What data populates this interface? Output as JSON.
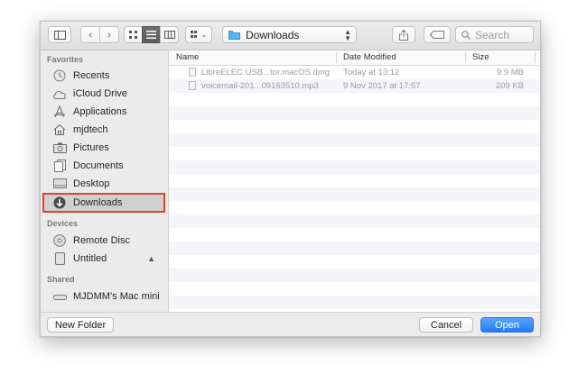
{
  "toolbar": {
    "sidebar_toggle_icon": "sidebar-icon",
    "back_icon": "chevron-left-icon",
    "forward_icon": "chevron-right-icon",
    "view_modes": [
      "icon-view-icon",
      "list-view-icon",
      "column-view-icon"
    ],
    "group_icon": "group-by-icon",
    "location": "Downloads",
    "share_icon": "share-icon",
    "tags_icon": "tag-icon",
    "search_placeholder": "Search"
  },
  "sidebar": {
    "favorites_title": "Favorites",
    "favorites": [
      {
        "label": "Recents",
        "icon": "clock-icon"
      },
      {
        "label": "iCloud Drive",
        "icon": "cloud-icon"
      },
      {
        "label": "Applications",
        "icon": "applications-icon"
      },
      {
        "label": "mjdtech",
        "icon": "home-icon"
      },
      {
        "label": "Pictures",
        "icon": "camera-icon"
      },
      {
        "label": "Documents",
        "icon": "document-icon"
      },
      {
        "label": "Desktop",
        "icon": "desktop-icon"
      },
      {
        "label": "Downloads",
        "icon": "download-icon",
        "selected": true
      }
    ],
    "devices_title": "Devices",
    "devices": [
      {
        "label": "Remote Disc",
        "icon": "disc-icon"
      },
      {
        "label": "Untitled",
        "icon": "drive-icon",
        "eject": "▲"
      }
    ],
    "shared_title": "Shared",
    "shared": [
      {
        "label": "MJDMM’s Mac mini",
        "icon": "computer-icon"
      }
    ]
  },
  "filelist": {
    "columns": [
      "Name",
      "Date Modified",
      "Size"
    ],
    "rows": [
      {
        "name": "LibreELEC.USB...tor.macOS.dmg",
        "date": "Today at 13:12",
        "size": "9.9 MB"
      },
      {
        "name": "voicemail-201...09163510.mp3",
        "date": "9 Nov 2017 at 17:57",
        "size": "209 KB"
      }
    ]
  },
  "footer": {
    "new_folder": "New Folder",
    "cancel": "Cancel",
    "open": "Open"
  },
  "colors": {
    "accent": "#1f7cf5",
    "highlight_border": "#e8402a"
  }
}
